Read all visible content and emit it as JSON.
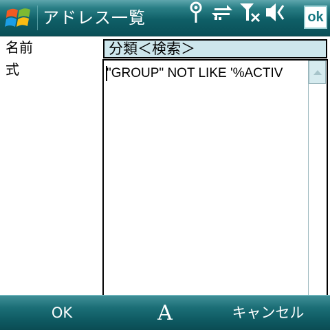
{
  "titlebar": {
    "title": "アドレス一覧",
    "ok_label": "ok",
    "icons": [
      "start-logo-icon",
      "antenna-icon",
      "data-sync-icon",
      "no-signal-icon",
      "speaker-icon"
    ]
  },
  "form": {
    "name_label": "名前",
    "name_value": "分類＜検索＞",
    "expression_label": "式",
    "expression_value": "\"GROUP\" NOT LIKE '%ACTIV"
  },
  "softkeys": {
    "left_label": "OK",
    "ime_label": "A",
    "right_label": "キャンセル"
  },
  "colors": {
    "titlebar": "#0f5f67",
    "field_background": "#cde6ec",
    "scrollbar_button": "#d6ebef"
  }
}
